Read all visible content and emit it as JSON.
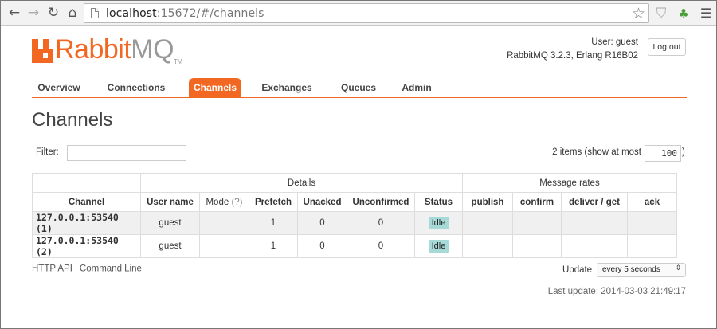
{
  "browser": {
    "url_host": "localhost",
    "url_rest": ":15672/#/channels",
    "back_glyph": "←",
    "forward_glyph": "→",
    "reload_glyph": "↻",
    "home_glyph": "⌂",
    "star_glyph": "☆",
    "shield_glyph": "⛉",
    "puzzle_glyph": "♣",
    "menu_glyph": "☰"
  },
  "header": {
    "logo_rabbit": "Rabbit",
    "logo_mq": "MQ",
    "logo_tm": "TM",
    "user_line": "User: guest",
    "version_prefix": "RabbitMQ 3.2.3, ",
    "erlang_link": "Erlang R16B02",
    "logout_label": "Log out",
    "brand_color": "#f26822"
  },
  "tabs": [
    {
      "label": "Overview"
    },
    {
      "label": "Connections"
    },
    {
      "label": "Channels",
      "active": true
    },
    {
      "label": "Exchanges"
    },
    {
      "label": "Queues"
    },
    {
      "label": "Admin"
    }
  ],
  "page_title": "Channels",
  "filter": {
    "label": "Filter:",
    "value": "",
    "items_text": "2 items (show at most",
    "max_value": "100",
    "close_paren": ")"
  },
  "table": {
    "group_details": "Details",
    "group_rates": "Message rates",
    "headers": {
      "channel": "Channel",
      "user": "User name",
      "mode": "Mode",
      "mode_hint": "(?)",
      "prefetch": "Prefetch",
      "unacked": "Unacked",
      "unconfirmed": "Unconfirmed",
      "status": "Status",
      "publish": "publish",
      "confirm": "confirm",
      "deliver_get": "deliver / get",
      "ack": "ack"
    },
    "rows": [
      {
        "channel": "127.0.0.1:53540 (1)",
        "user": "guest",
        "mode": "",
        "prefetch": "1",
        "unacked": "0",
        "unconfirmed": "0",
        "status": "Idle",
        "publish": "",
        "confirm": "",
        "deliver_get": "",
        "ack": ""
      },
      {
        "channel": "127.0.0.1:53540 (2)",
        "user": "guest",
        "mode": "",
        "prefetch": "1",
        "unacked": "0",
        "unconfirmed": "0",
        "status": "Idle",
        "publish": "",
        "confirm": "",
        "deliver_get": "",
        "ack": ""
      }
    ]
  },
  "footer": {
    "http_api": "HTTP API",
    "command_line": "Command Line",
    "update_label": "Update",
    "update_value": "every 5 seconds",
    "update_arrow": "⇕",
    "last_update": "Last update: 2014-03-03 21:49:17"
  }
}
